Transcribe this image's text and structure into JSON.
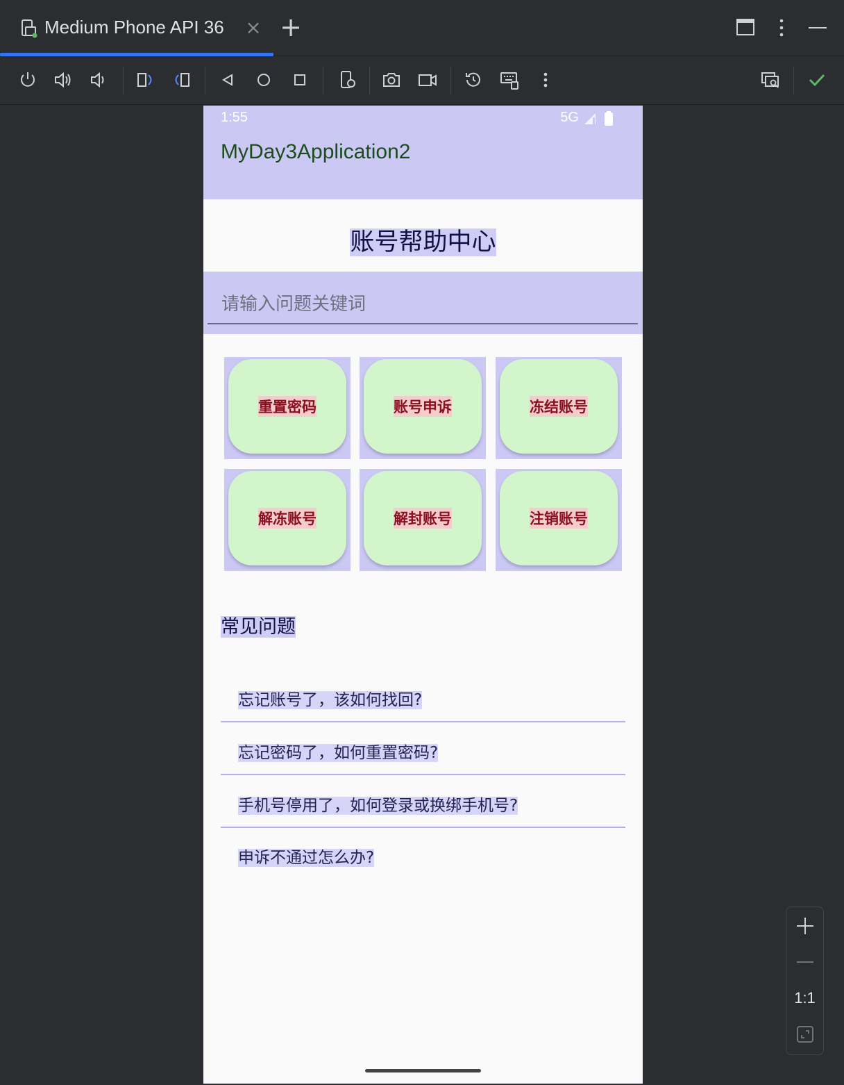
{
  "tab": {
    "title": "Medium Phone API 36",
    "close": "×",
    "add": "+"
  },
  "toolbar_icons": [
    "power-icon",
    "volume-up-icon",
    "volume-down-icon",
    "rotate-left-icon",
    "rotate-right-icon",
    "back-icon",
    "home-icon",
    "overview-icon",
    "device-settings-icon",
    "camera-icon",
    "screen-record-icon",
    "reset-icon",
    "keyboard-icon",
    "more-icon",
    "device-mirror-icon",
    "check-icon"
  ],
  "phone": {
    "status": {
      "time": "1:55",
      "network": "5G"
    },
    "app_title": "MyDay3Application2",
    "help_title": "账号帮助中心",
    "search_placeholder": "请输入问题关键词",
    "actions": [
      "重置密码",
      "账号申诉",
      "冻结账号",
      "解冻账号",
      "解封账号",
      "注销账号"
    ],
    "faq_heading": "常见问题",
    "faq": [
      "忘记账号了，该如何找回?",
      "忘记密码了，如何重置密码?",
      "手机号停用了，如何登录或换绑手机号?",
      "申诉不通过怎么办?"
    ]
  },
  "zoom": {
    "ratio": "1:1"
  },
  "colors": {
    "accent": "#3574f0",
    "appbar": "#cbc9f3",
    "button_fill": "#d3f5cc",
    "button_text": "#8a1020"
  }
}
